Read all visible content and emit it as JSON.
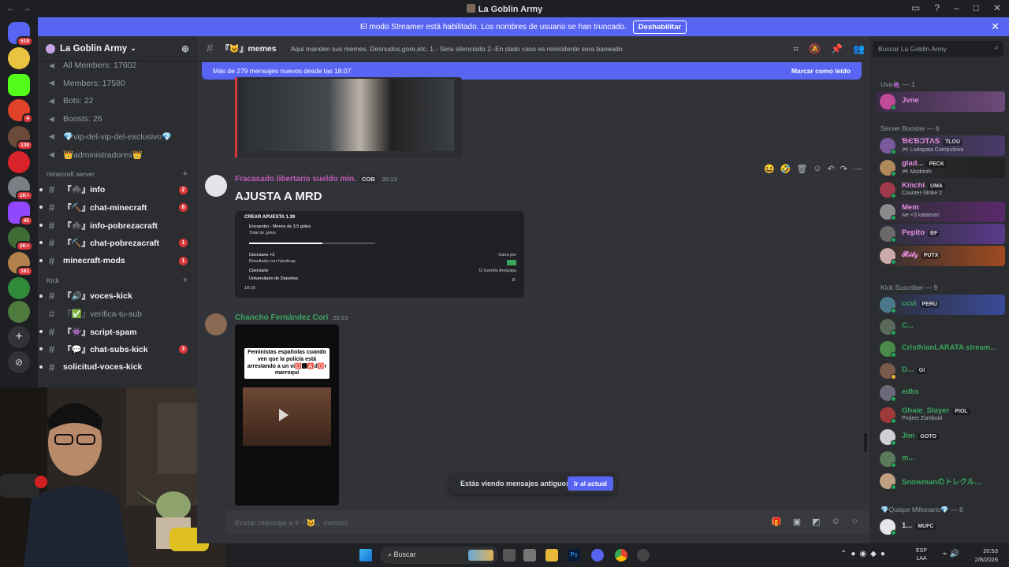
{
  "window": {
    "title": "La Goblin Army"
  },
  "banner": {
    "text": "El modo Streamer está habilitado. Los nombres de usuario se han truncado.",
    "button": "Deshabilitar"
  },
  "server_badges": [
    "519",
    "4",
    "139",
    "1K+",
    "45",
    "2K+",
    "161"
  ],
  "sidebar": {
    "guild_name": "La Goblin Army",
    "stats": [
      {
        "label": "All Members: 17602"
      },
      {
        "label": "Members: 17580"
      },
      {
        "label": "Bots: 22"
      },
      {
        "label": "Boosts: 26"
      },
      {
        "label": "💎vip-del-vip-del-exclusivo💎"
      },
      {
        "label": "👑administradores👑"
      }
    ],
    "cat_minecraft": "minecraft server",
    "minecraft_channels": [
      {
        "label": "『🕷️』info",
        "count": "2"
      },
      {
        "label": "『⛏️』chat-minecraft",
        "count": "6"
      },
      {
        "label": "『🕷️』info-pobrezacraft",
        "count": ""
      },
      {
        "label": "『⛏️』chat-pobrezacraft",
        "count": "1"
      },
      {
        "label": "minecraft-mods",
        "count": "1"
      }
    ],
    "cat_kick": "Kick",
    "kick_channels": [
      {
        "label": "『🔊』voces-kick",
        "count": "",
        "bright": true
      },
      {
        "label": "『✅』verifica-tu-sub",
        "count": "",
        "bright": false
      },
      {
        "label": "『👾』script-spam",
        "count": "",
        "bright": true
      },
      {
        "label": "『💬』chat-subs-kick",
        "count": "3",
        "bright": true
      },
      {
        "label": "solicitud-voces-kick",
        "count": "",
        "bright": true
      }
    ]
  },
  "channel": {
    "name": "『😺』memes",
    "topic": "Aqui manden sus memes. Desnudos,gore,etc. 1.- Sera silenciado 2.-En dado caso es reincidente sera baneado",
    "new_messages": "Más de 279 mensajes nuevos desde las 18:07",
    "mark_read": "Marcar como leído"
  },
  "messages": [
    {
      "author": "Fracasado libertario sueldo min.",
      "tag": "COB",
      "time": "20:13",
      "text": "AJUSTA A MRD",
      "author_color": "#c25ab7",
      "card": {
        "title": "CREAR APUESTA 1.39",
        "line1": "Encuentro - Menos de 3.5 goles",
        "line1b": "Total de goles",
        "line2": "Cienciano +2",
        "line2b": "Resultado con hándicap",
        "team1": "Cienciano",
        "team2": "Universitario de Deportes",
        "score1": "2",
        "score2": "0",
        "side1": "Gana por",
        "side2": "G Garrido Arequipa",
        "stamp": "18:29"
      }
    },
    {
      "author": "Chancho Fernández Cori",
      "time": "20:13",
      "author_color": "#3ba55d",
      "video_caption": "Feministas españolas cuando ven que la policía está arrestando a un vi🅾️🅻🅰️d🅾️r marroquí"
    }
  ],
  "old_messages_note": "Estás viendo mensajes antiguos",
  "jump_button": "Ir al actual",
  "composer": {
    "placeholder": "Enviar mensaje a #『😺』memes"
  },
  "members_search": "Buscar La Goblin Army",
  "member_groups": [
    {
      "title": "Uva🍇 — 1",
      "members": [
        {
          "name": "Jvne",
          "color": "#e78ee0",
          "tag": "",
          "sub": ""
        }
      ]
    },
    {
      "title": "Server Booster — 6",
      "members": [
        {
          "name": "ƁЄƁƆƬΛS",
          "color": "#e78ee0",
          "tag": "TLOU",
          "sub": "🎮 Ludopata Compulsivo"
        },
        {
          "name": "glad...",
          "color": "#e78ee0",
          "tag": "PECK",
          "sub": "🎮 Modrinth"
        },
        {
          "name": "Kinchi",
          "color": "#e78ee0",
          "tag": "UMA",
          "sub": "Counter-Strike 2"
        },
        {
          "name": "Mem",
          "color": "#e78ee0",
          "tag": "",
          "sub": "we <3 katamari"
        },
        {
          "name": "Pepito",
          "color": "#e78ee0",
          "tag": "BF",
          "sub": ""
        },
        {
          "name": "𝓡𝓲𝓽𝔃",
          "color": "#e78ee0",
          "tag": "PUTX",
          "sub": ""
        }
      ]
    },
    {
      "title": "Kick Suscriber — 9",
      "members": [
        {
          "name": "ccvi",
          "color": "#3ba55d",
          "tag": "PERU",
          "sub": ""
        },
        {
          "name": "C...",
          "color": "#3ba55d",
          "tag": "",
          "sub": ""
        },
        {
          "name": "CristhianLARATA stream...",
          "color": "#3ba55d",
          "tag": "",
          "sub": ""
        },
        {
          "name": "D...",
          "color": "#3ba55d",
          "tag": "GI",
          "sub": ""
        },
        {
          "name": "edks",
          "color": "#3ba55d",
          "tag": "",
          "sub": ""
        },
        {
          "name": "Ghale_Slayer",
          "color": "#3ba55d",
          "tag": "PIOL",
          "sub": "Project Zomboid"
        },
        {
          "name": "Jim",
          "color": "#3ba55d",
          "tag": "GOTO",
          "sub": ""
        },
        {
          "name": "m...",
          "color": "#3ba55d",
          "tag": "",
          "sub": ""
        },
        {
          "name": "Snowmanのトレクル...",
          "color": "#3ba55d",
          "tag": "",
          "sub": ""
        }
      ]
    },
    {
      "title": "💎Quispe Millonario💎 — 8",
      "members": [
        {
          "name": "1...",
          "color": "#dbdee1",
          "tag": "MUFC",
          "sub": ""
        }
      ]
    }
  ],
  "taskbar": {
    "search": "Buscar",
    "lang": "ESP",
    "lang2": "LAA",
    "time": "20:53",
    "date": "2/8/2026"
  }
}
